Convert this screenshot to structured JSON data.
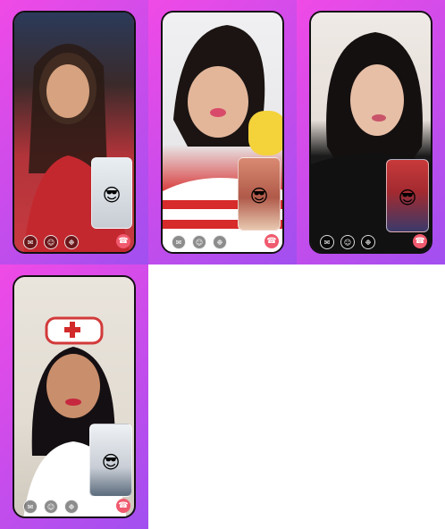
{
  "colors": {
    "tile_gradient_start": "#f04ae6",
    "tile_gradient_end": "#a24ff0",
    "phone_border": "#111111",
    "end_call": "#f05a6e"
  },
  "icons": {
    "chat": "chat-bubble-icon",
    "effects": "face-filter-icon",
    "gift": "gift-icon",
    "end_call": "phone-hangup-icon",
    "pip_emoji": "sunglasses-emoji-icon"
  },
  "glyphs": {
    "chat": "✉",
    "effects": "☺",
    "gift": "❉",
    "end_call": "☎",
    "pip_emoji": "😎"
  },
  "screens": [
    {
      "id": "call-1"
    },
    {
      "id": "call-2"
    },
    {
      "id": "call-3"
    },
    {
      "id": "call-4"
    }
  ]
}
